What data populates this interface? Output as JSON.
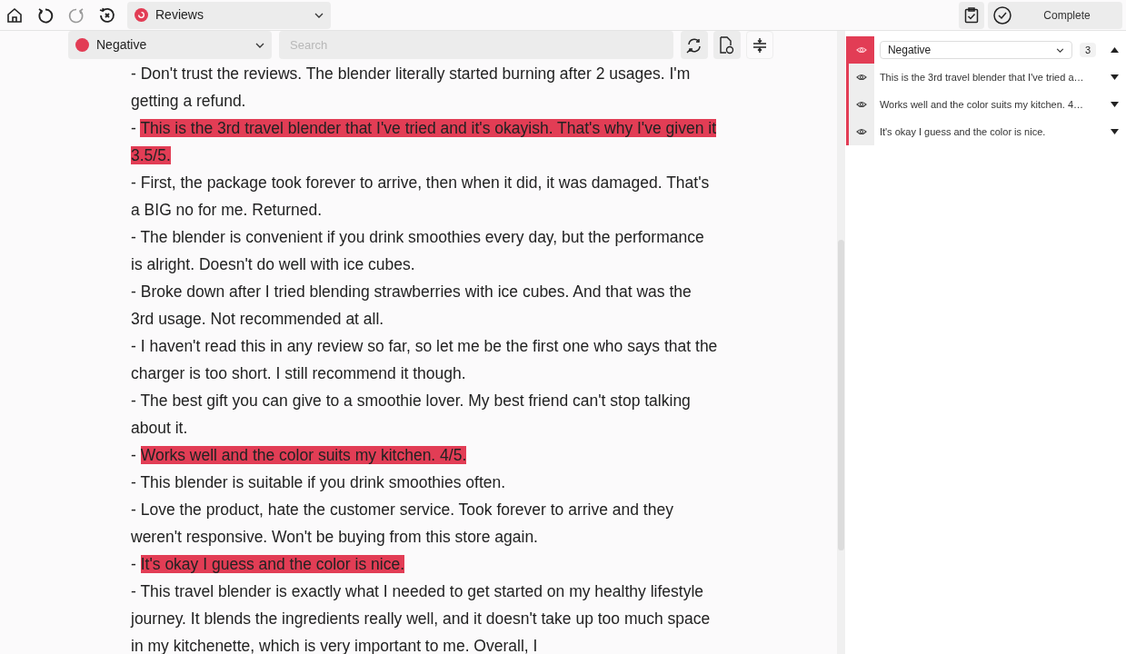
{
  "toolbar": {
    "document": "Reviews",
    "complete_button": "Complete"
  },
  "filter": {
    "label": "Negative",
    "color": "#e23d55",
    "search_placeholder": "Search"
  },
  "reviews": [
    {
      "dash": "-",
      "text": "Don't trust the reviews. The blender literally started burning after 2 usages. I'm getting a refund.",
      "highlighted": false
    },
    {
      "dash": "-",
      "text": "This is the 3rd travel blender that I've tried and it's okayish. That's why I've given it 3.5/5.",
      "highlighted": true
    },
    {
      "dash": "-",
      "text": "First, the package took forever to arrive, then when it did, it was damaged. That's a BIG no for me. Returned.",
      "highlighted": false
    },
    {
      "dash": "-",
      "text": "The blender is convenient if you drink smoothies every day, but the performance is alright. Doesn't do well with ice cubes.",
      "highlighted": false
    },
    {
      "dash": "-",
      "text": "Broke down after I tried blending strawberries with ice cubes. And that was the 3rd usage. Not recommended at all.",
      "highlighted": false
    },
    {
      "dash": "-",
      "text": "I haven't read this in any review so far, so let me be the first one who says that the charger is too short. I still recommend it though.",
      "highlighted": false
    },
    {
      "dash": "-",
      "text": "The best gift you can give to a smoothie lover. My best friend can't stop talking about it.",
      "highlighted": false
    },
    {
      "dash": "-",
      "text": "Works well and the color suits my kitchen. 4/5.",
      "highlighted": true
    },
    {
      "dash": "-",
      "text": "This blender is suitable if you drink smoothies often.",
      "highlighted": false
    },
    {
      "dash": "-",
      "text": "Love the product, hate the customer service. Took forever to arrive and they weren't responsive. Won't be buying from this store again.",
      "highlighted": false
    },
    {
      "dash": "-",
      "text": "It's okay I guess and the color is nice.",
      "highlighted": true
    },
    {
      "dash": "-",
      "text": "This travel blender is exactly what I needed to get started on my healthy lifestyle journey. It blends the ingredients really well, and it doesn't take up too much space in my kitchenette, which is very important to me. Overall, I",
      "highlighted": false
    }
  ],
  "annotations": {
    "label": "Negative",
    "count": "3",
    "color": "#e23d55",
    "expanded": true,
    "items": [
      {
        "text": "This is the 3rd travel blender that I've tried a…",
        "expanded": false
      },
      {
        "text": "Works well and the color suits my kitchen. 4…",
        "expanded": false
      },
      {
        "text": "It's okay I guess and the color is nice.",
        "expanded": false
      }
    ]
  }
}
